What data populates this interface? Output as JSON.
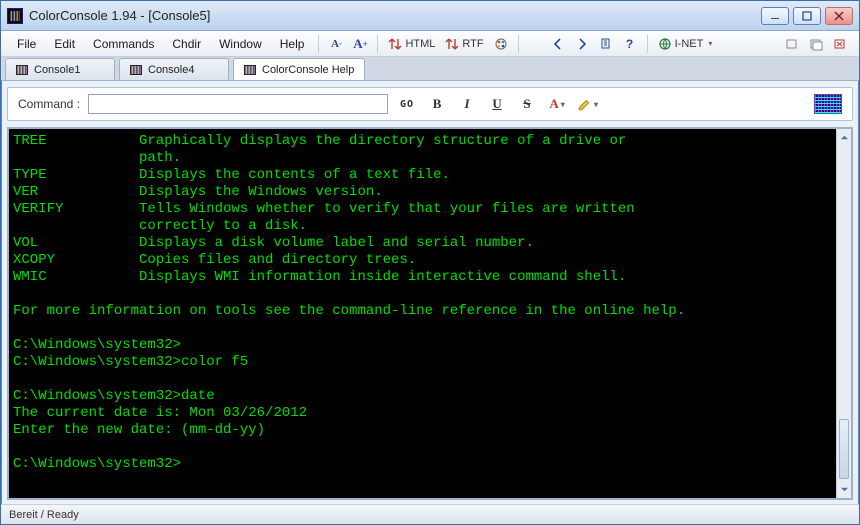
{
  "window": {
    "title": "ColorConsole 1.94  - [Console5]"
  },
  "menu": {
    "file": "File",
    "edit": "Edit",
    "commands": "Commands",
    "chdir": "Chdir",
    "window": "Window",
    "help": "Help",
    "html": "HTML",
    "rtf": "RTF",
    "inet": "I-NET"
  },
  "tabs": [
    {
      "label": "Console1"
    },
    {
      "label": "Console4"
    },
    {
      "label": "ColorConsole Help",
      "active": true
    }
  ],
  "command": {
    "label": "Command :",
    "value": "",
    "go": "GO"
  },
  "console": {
    "lines": [
      {
        "cmd": "TREE",
        "desc": "Graphically displays the directory structure of a drive or"
      },
      {
        "cmd": "",
        "desc": "path."
      },
      {
        "cmd": "TYPE",
        "desc": "Displays the contents of a text file."
      },
      {
        "cmd": "VER",
        "desc": "Displays the Windows version."
      },
      {
        "cmd": "VERIFY",
        "desc": "Tells Windows whether to verify that your files are written"
      },
      {
        "cmd": "",
        "desc": "correctly to a disk."
      },
      {
        "cmd": "VOL",
        "desc": "Displays a disk volume label and serial number."
      },
      {
        "cmd": "XCOPY",
        "desc": "Copies files and directory trees."
      },
      {
        "cmd": "WMIC",
        "desc": "Displays WMI information inside interactive command shell."
      }
    ],
    "more": "For more information on tools see the command-line reference in the online help.",
    "prompts": [
      "C:\\Windows\\system32>",
      "C:\\Windows\\system32>color f5",
      "",
      "C:\\Windows\\system32>date",
      "The current date is: Mon 03/26/2012",
      "Enter the new date: (mm-dd-yy)",
      "",
      "C:\\Windows\\system32>"
    ]
  },
  "status": {
    "text": "Bereit / Ready"
  }
}
